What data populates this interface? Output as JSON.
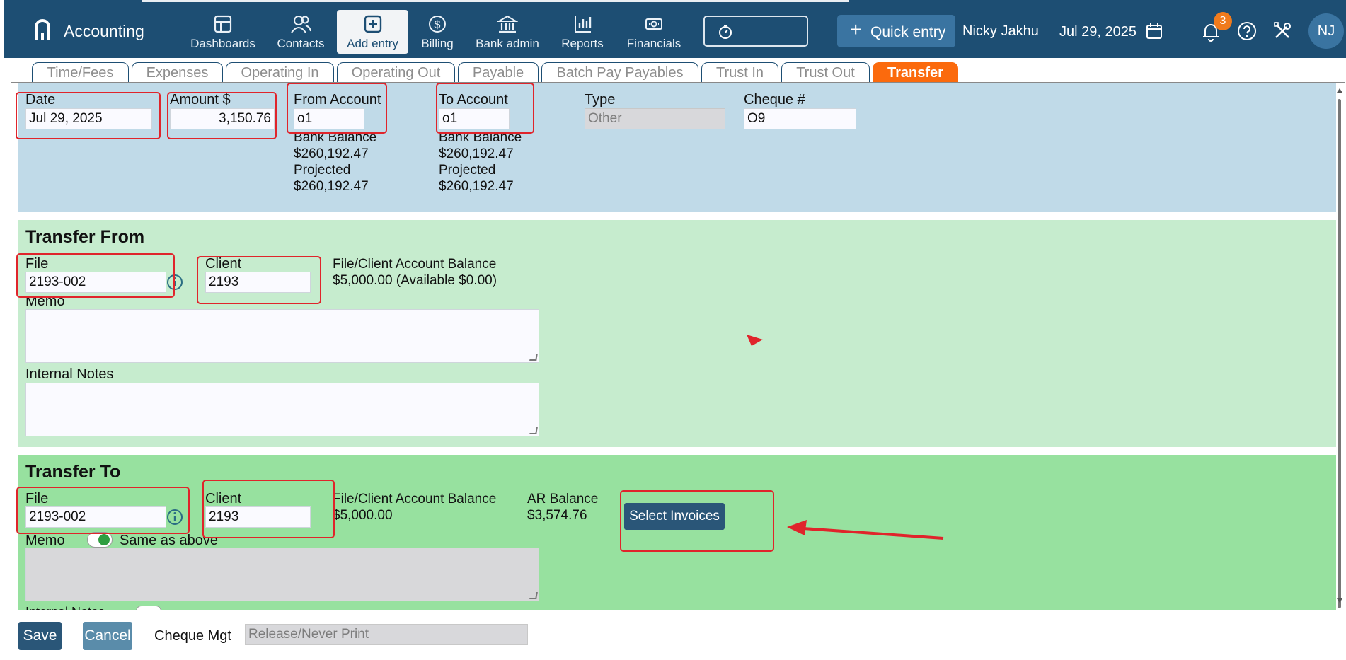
{
  "app": {
    "title": "Accounting"
  },
  "nav": [
    {
      "label": "Dashboards",
      "icon": "dashboard-icon"
    },
    {
      "label": "Contacts",
      "icon": "contacts-icon"
    },
    {
      "label": "Add entry",
      "icon": "add-entry-icon",
      "active": true
    },
    {
      "label": "Billing",
      "icon": "billing-dollar-icon"
    },
    {
      "label": "Bank admin",
      "icon": "bank-icon"
    },
    {
      "label": "Reports",
      "icon": "reports-chart-icon"
    },
    {
      "label": "Financials",
      "icon": "financials-cash-icon"
    }
  ],
  "header": {
    "quick_entry": "Quick entry",
    "user_name": "Nicky Jakhu",
    "date": "Jul 29, 2025",
    "notification_count": "3",
    "avatar_initials": "NJ"
  },
  "tabs": [
    {
      "label": "Time/Fees"
    },
    {
      "label": "Expenses"
    },
    {
      "label": "Operating In"
    },
    {
      "label": "Operating Out"
    },
    {
      "label": "Payable"
    },
    {
      "label": "Batch Pay Payables"
    },
    {
      "label": "Trust In"
    },
    {
      "label": "Trust Out"
    },
    {
      "label": "Transfer",
      "active": true
    }
  ],
  "header_form": {
    "date_label": "Date",
    "date_value": "Jul 29, 2025",
    "amount_label": "Amount $",
    "amount_value": "3,150.76",
    "from_account_label": "From Account",
    "from_account_value": "o1",
    "from_bank_balance_label": "Bank Balance",
    "from_bank_balance": "$260,192.47",
    "from_projected_label": "Projected",
    "from_projected": "$260,192.47",
    "to_account_label": "To Account",
    "to_account_value": "o1",
    "to_bank_balance_label": "Bank Balance",
    "to_bank_balance": "$260,192.47",
    "to_projected_label": "Projected",
    "to_projected": "$260,192.47",
    "type_label": "Type",
    "type_value": "Other",
    "cheque_label": "Cheque #",
    "cheque_value": "O9"
  },
  "transfer_from": {
    "title": "Transfer From",
    "file_label": "File",
    "file_value": "2193-002",
    "client_label": "Client",
    "client_value": "2193",
    "balance_label": "File/Client Account Balance",
    "balance_value": "$5,000.00 (Available $0.00)",
    "memo_label": "Memo",
    "internal_notes_label": "Internal Notes"
  },
  "transfer_to": {
    "title": "Transfer To",
    "file_label": "File",
    "file_value": "2193-002",
    "client_label": "Client",
    "client_value": "2193",
    "balance_label": "File/Client Account Balance",
    "balance_value": "$5,000.00",
    "ar_label": "AR Balance",
    "ar_value": "$3,574.76",
    "select_invoices": "Select Invoices",
    "memo_label": "Memo",
    "same_as_above": "Same as above",
    "internal_notes_label": "Internal Notes"
  },
  "footer": {
    "save": "Save",
    "cancel": "Cancel",
    "cheque_mgt_label": "Cheque Mgt",
    "cheque_mgt_placeholder": "Release/Never Print"
  },
  "colors": {
    "header_bg": "#1d4e73",
    "active_tab": "#fb6a0d",
    "section_top": "#c0dae8",
    "section_from": "#c6ecce",
    "section_to": "#97e19f",
    "annotation_red": "#e0242b"
  }
}
